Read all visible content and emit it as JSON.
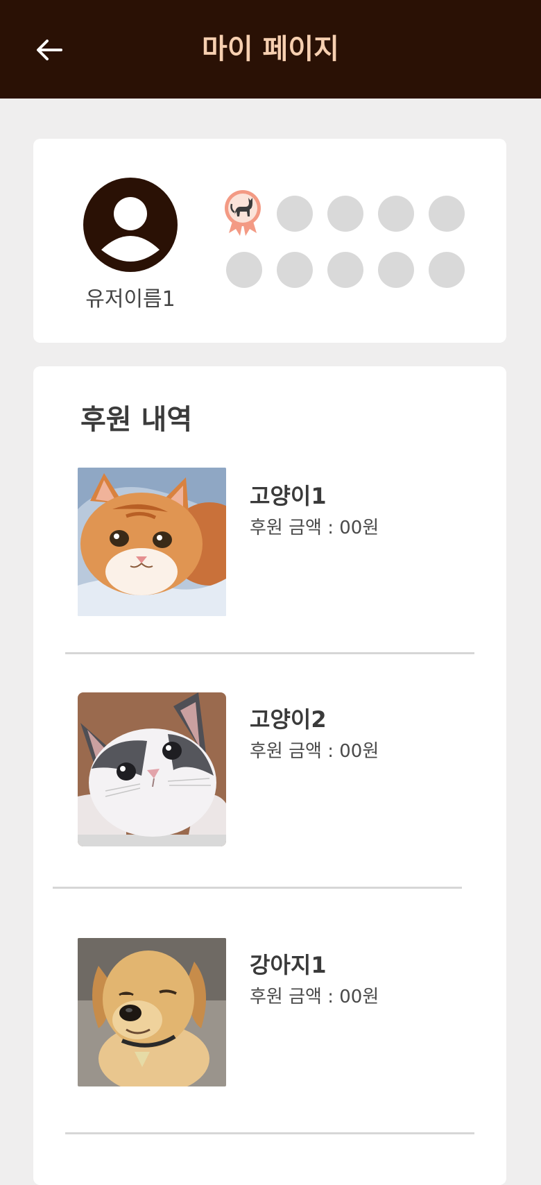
{
  "header": {
    "title": "마이 페이지",
    "back_icon": "arrow-left-icon"
  },
  "profile": {
    "avatar_icon": "user-avatar-icon",
    "username": "유저이름1",
    "badges_total": 10,
    "badges_earned": 1,
    "earned_badge_icon": "cat-ribbon-badge-icon"
  },
  "donations": {
    "title": "후원 내역",
    "items": [
      {
        "name": "고양이1",
        "amount_text": "후원 금액 : 00원",
        "image": "orange-tabby-kitten-photo"
      },
      {
        "name": "고양이2",
        "amount_text": "후원 금액 : 00원",
        "image": "grey-white-kitten-photo"
      },
      {
        "name": "강아지1",
        "amount_text": "후원 금액 : 00원",
        "image": "golden-retriever-puppy-photo"
      }
    ]
  },
  "colors": {
    "header_bg": "#2a1105",
    "header_title": "#f6cfb0",
    "page_bg": "#efeeee",
    "badge_empty": "#d9d9d9",
    "badge_ribbon": "#f39a84"
  }
}
